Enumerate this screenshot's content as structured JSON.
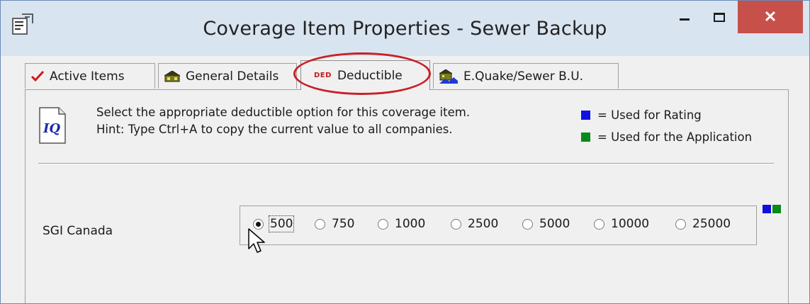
{
  "window": {
    "title": "Coverage Item Properties - Sewer Backup",
    "minimize_glyph": "",
    "maximize_glyph": "",
    "close_glyph": "✕"
  },
  "tabs": [
    {
      "label": "Active Items",
      "icon": "checkmark-icon",
      "active": false
    },
    {
      "label": "General Details",
      "icon": "house-icon",
      "active": false
    },
    {
      "label": "Deductible",
      "icon": "ded-icon",
      "badge": "DED",
      "active": true
    },
    {
      "label": "E.Quake/Sewer B.U.",
      "icon": "quake-house-icon",
      "active": false
    }
  ],
  "hint": {
    "line1": "Select the appropriate deductible option for this coverage item.",
    "line2": "Hint: Type Ctrl+A to copy the current value to all companies.",
    "icon": "iq-document-icon"
  },
  "legend": {
    "rating_label": "= Used for Rating",
    "rating_color": "#1010e0",
    "application_label": "= Used for the Application",
    "application_color": "#0a8a1a"
  },
  "company": {
    "name": "SGI Canada",
    "options": [
      "500",
      "750",
      "1000",
      "2500",
      "5000",
      "10000",
      "25000"
    ],
    "selected": "500"
  },
  "colors": {
    "highlight": "#c8202a",
    "close_button": "#c7504b",
    "titlebar": "#d9e4f1"
  }
}
